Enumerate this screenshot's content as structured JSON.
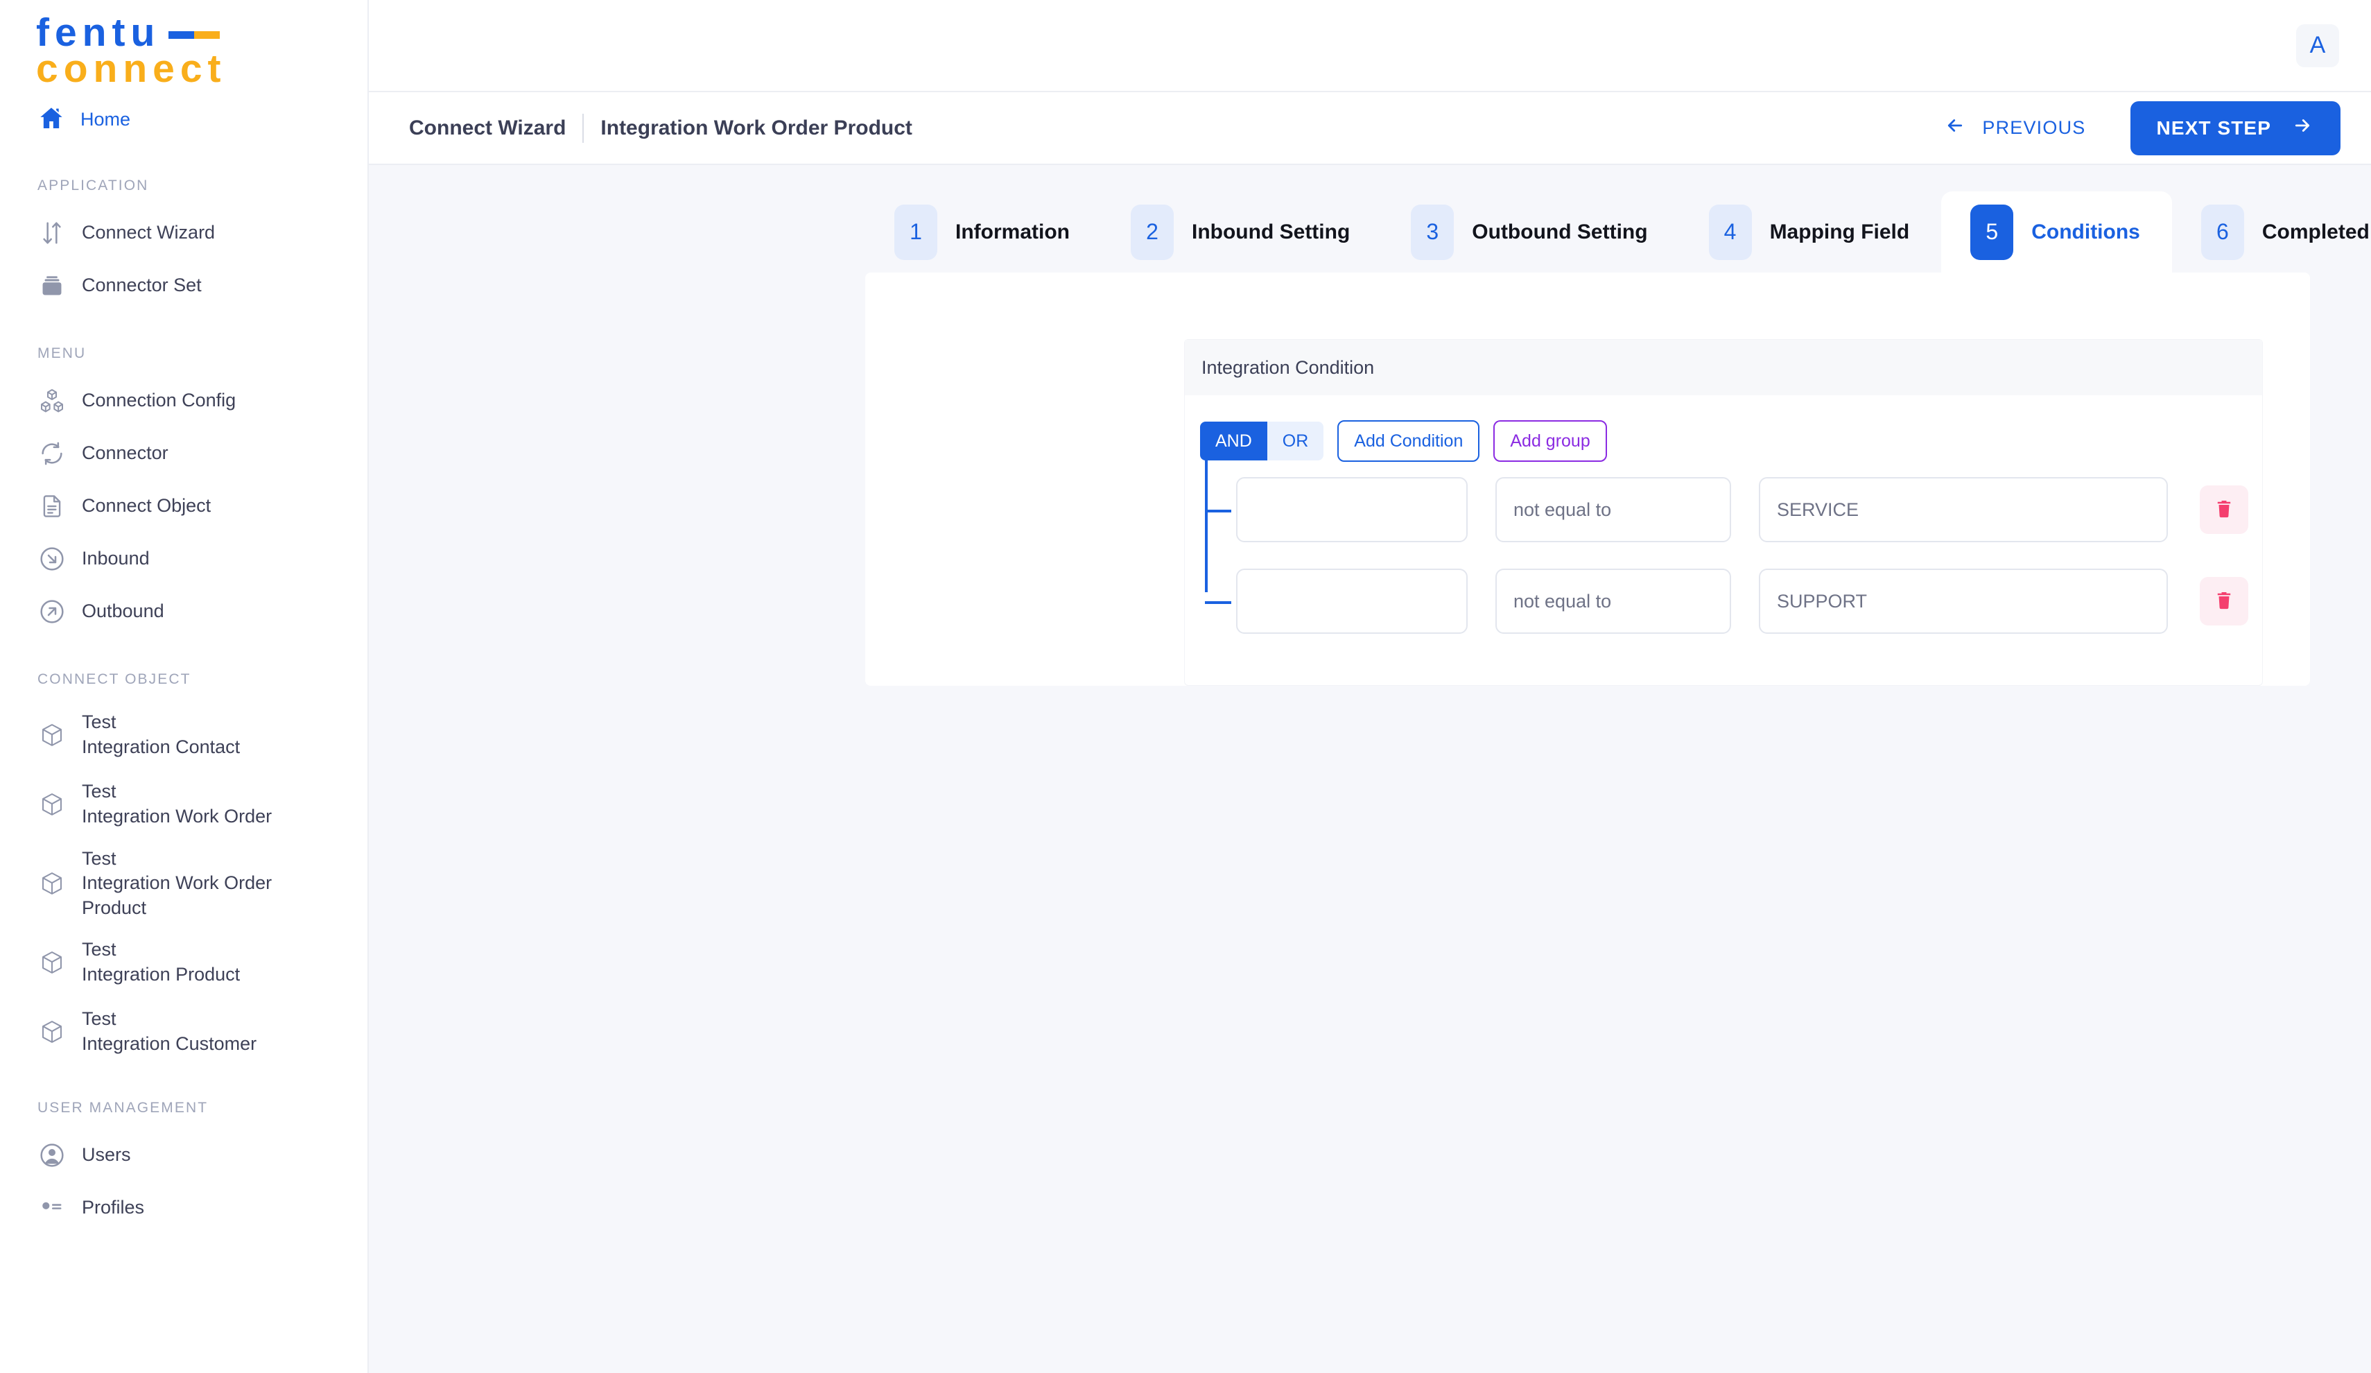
{
  "brand": {
    "line1": "fentu",
    "line2": "connect"
  },
  "sidebar": {
    "home": {
      "label": "Home",
      "icon": "home-icon"
    },
    "sections": [
      {
        "title": "APPLICATION",
        "items": [
          {
            "label": "Connect Wizard",
            "icon": "transfer-arrows-icon"
          },
          {
            "label": "Connector Set",
            "icon": "stack-icon"
          }
        ]
      },
      {
        "title": "MENU",
        "items": [
          {
            "label": "Connection Config",
            "icon": "cubes-icon"
          },
          {
            "label": "Connector",
            "icon": "refresh-circle-icon"
          },
          {
            "label": "Connect Object",
            "icon": "document-icon"
          },
          {
            "label": "Inbound",
            "icon": "arrow-down-right-circle-icon"
          },
          {
            "label": "Outbound",
            "icon": "arrow-up-right-circle-icon"
          }
        ]
      },
      {
        "title": "CONNECT OBJECT",
        "items": [
          {
            "label": "Test",
            "label2": "Integration Contact",
            "icon": "cube-icon"
          },
          {
            "label": "Test",
            "label2": "Integration Work Order",
            "icon": "cube-icon"
          },
          {
            "label": "Test",
            "label2": "Integration Work Order",
            "label3": "Product",
            "icon": "cube-icon"
          },
          {
            "label": "Test",
            "label2": "Integration Product",
            "icon": "cube-icon"
          },
          {
            "label": "Test",
            "label2": "Integration Customer",
            "icon": "cube-icon"
          }
        ]
      },
      {
        "title": "USER MANAGEMENT",
        "items": [
          {
            "label": "Users",
            "icon": "user-circle-icon"
          },
          {
            "label": "Profiles",
            "icon": "list-dot-icon"
          }
        ]
      }
    ]
  },
  "topbar": {
    "avatar_initial": "A"
  },
  "breadcrumb": {
    "parent": "Connect Wizard",
    "current": "Integration Work Order Product"
  },
  "actions": {
    "previous_label": "PREVIOUS",
    "previous_icon": "arrow-left-icon",
    "next_label": "NEXT STEP",
    "next_icon": "arrow-right-icon"
  },
  "wizard": {
    "active_step": 5,
    "steps": [
      {
        "num": "1",
        "label": "Information"
      },
      {
        "num": "2",
        "label": "Inbound Setting"
      },
      {
        "num": "3",
        "label": "Outbound Setting"
      },
      {
        "num": "4",
        "label": "Mapping Field"
      },
      {
        "num": "5",
        "label": "Conditions"
      },
      {
        "num": "6",
        "label": "Completed"
      }
    ]
  },
  "condition_panel": {
    "title": "Integration Condition",
    "logic": {
      "and_label": "AND",
      "or_label": "OR",
      "selected": "AND"
    },
    "add_condition_label": "Add Condition",
    "add_group_label": "Add group",
    "delete_icon": "trash-icon",
    "rows": [
      {
        "field": "",
        "operator": "not equal to",
        "value": "SERVICE"
      },
      {
        "field": "",
        "operator": "not equal to",
        "value": "SUPPORT"
      }
    ]
  },
  "colors": {
    "brand_blue": "#1a61e0",
    "brand_yellow": "#f9ae1b",
    "purple": "#8b2be2",
    "danger": "#f43f6e",
    "page_bg": "#f6f7fb"
  }
}
